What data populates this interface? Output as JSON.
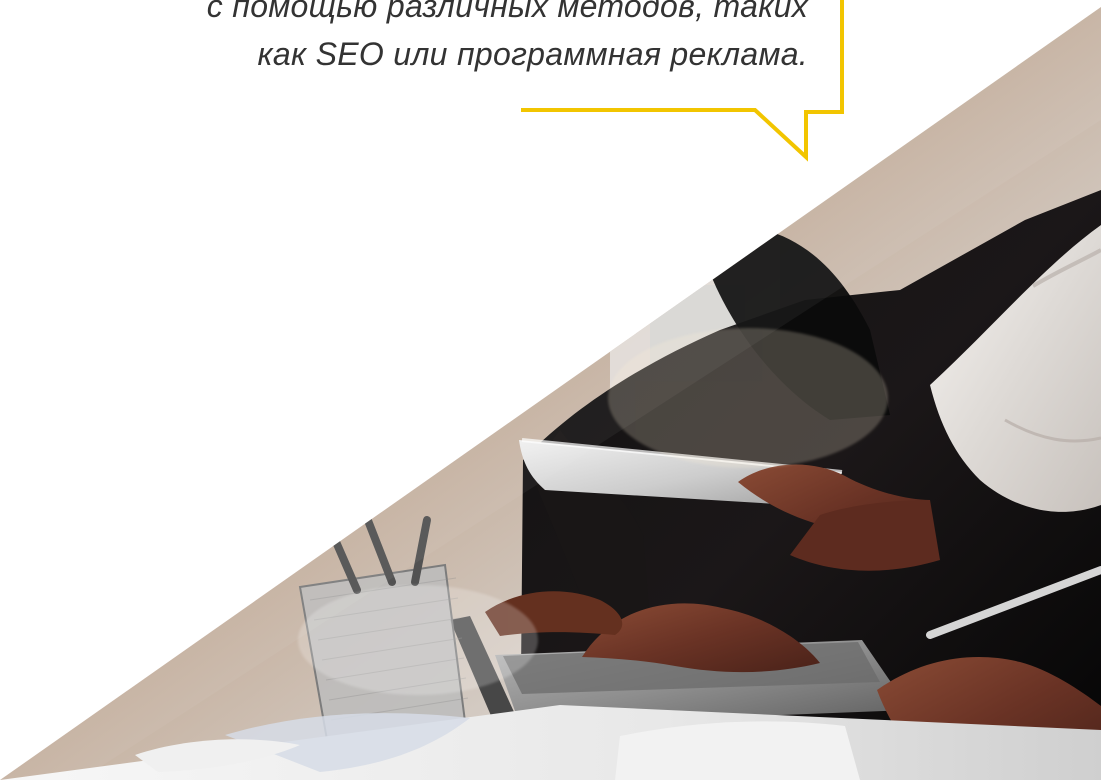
{
  "quote": {
    "lines": [
      "с помощью различных методов, таких",
      "как SEO или программная реклама."
    ]
  },
  "colors": {
    "accent": "#f2c500",
    "text": "#333333",
    "background": "#ffffff"
  },
  "decorative": {
    "callout": "yellow-callout-shape",
    "image": "office-team-with-laptop-and-tablet-photo"
  }
}
